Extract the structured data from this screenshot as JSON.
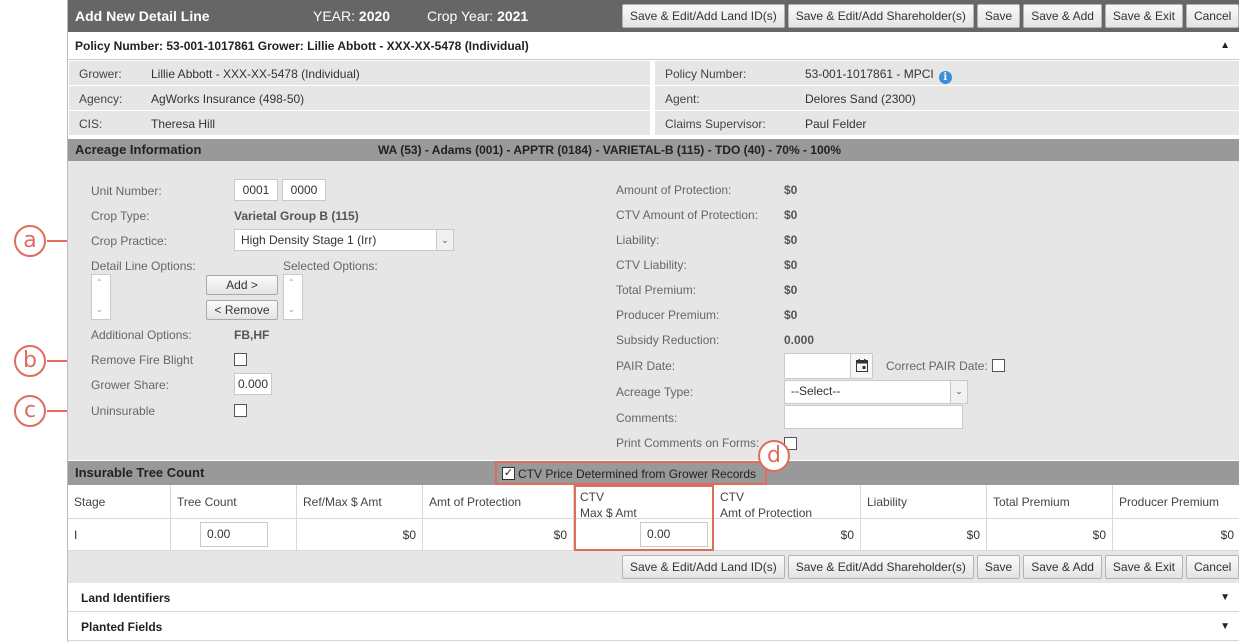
{
  "header": {
    "title": "Add New Detail Line",
    "year_label": "YEAR:",
    "year_value": "2020",
    "crop_year_label": "Crop Year:",
    "crop_year_value": "2021",
    "buttons": [
      "Save & Edit/Add Land ID(s)",
      "Save & Edit/Add Shareholder(s)",
      "Save",
      "Save & Add",
      "Save & Exit",
      "Cancel"
    ]
  },
  "policy_header": {
    "text": "Policy Number: 53-001-1017861 Grower: Lillie Abbott - XXX-XX-5478 (Individual)",
    "caret": "▲"
  },
  "info": {
    "grower_label": "Grower:",
    "grower_value": "Lillie Abbott - XXX-XX-5478 (Individual)",
    "policy_label": "Policy Number:",
    "policy_value": "53-001-1017861 - MPCI",
    "agency_label": "Agency:",
    "agency_value": "AgWorks Insurance (498-50)",
    "agent_label": "Agent:",
    "agent_value": "Delores Sand (2300)",
    "cis_label": "CIS:",
    "cis_value": "Theresa Hill",
    "supervisor_label": "Claims Supervisor:",
    "supervisor_value": "Paul Felder"
  },
  "acreage": {
    "title": "Acreage Information",
    "summary": "WA (53) - Adams (001) - APPTR (0184) - VARIETAL-B (115) - TDO (40) - 70% - 100%",
    "unit_label": "Unit Number:",
    "unit_a": "0001",
    "unit_b": "0000",
    "crop_type_label": "Crop Type:",
    "crop_type_value": "Varietal Group B (115)",
    "crop_practice_label": "Crop Practice:",
    "crop_practice_value": "High Density Stage 1 (Irr)",
    "detail_options_label": "Detail Line Options:",
    "selected_options_label": "Selected Options:",
    "add_label": "Add >",
    "remove_label": "< Remove",
    "additional_label": "Additional Options:",
    "additional_value": "FB,HF",
    "fire_blight_label": "Remove Fire Blight",
    "grower_share_label": "Grower Share:",
    "grower_share_value": "0.000",
    "uninsurable_label": "Uninsurable",
    "right": {
      "amount_protection_label": "Amount of Protection:",
      "amount_protection_value": "$0",
      "ctv_amount_label": "CTV Amount of Protection:",
      "ctv_amount_value": "$0",
      "liability_label": "Liability:",
      "liability_value": "$0",
      "ctv_liability_label": "CTV Liability:",
      "ctv_liability_value": "$0",
      "total_premium_label": "Total Premium:",
      "total_premium_value": "$0",
      "producer_premium_label": "Producer Premium:",
      "producer_premium_value": "$0",
      "subsidy_label": "Subsidy Reduction:",
      "subsidy_value": "0.000",
      "pair_date_label": "PAIR Date:",
      "correct_pair_label": "Correct PAIR Date:",
      "acreage_type_label": "Acreage Type:",
      "acreage_type_value": "--Select--",
      "comments_label": "Comments:",
      "print_comments_label": "Print Comments on Forms:"
    }
  },
  "tree_count": {
    "title": "Insurable Tree Count",
    "ctv_checkbox_label": "CTV Price Determined from Grower Records",
    "columns": [
      "Stage",
      "Tree Count",
      "Ref/Max $ Amt",
      "Amt of Protection",
      "CTV",
      "Max $ Amt",
      "CTV",
      "Amt of Protection",
      "Liability",
      "Total Premium",
      "Producer Premium"
    ],
    "row": {
      "stage": "I",
      "tree_count": "0.00",
      "ref_max": "$0",
      "amt_protection": "$0",
      "ctv_max": "0.00",
      "ctv_amt_protection": "$0",
      "liability": "$0",
      "total_premium": "$0",
      "producer_premium": "$0"
    }
  },
  "sections": {
    "land_identifiers": "Land Identifiers",
    "planted_fields": "Planted Fields",
    "caret": "▼"
  },
  "callouts": [
    "a",
    "b",
    "c",
    "d"
  ],
  "colors": {
    "title_bar": "#666666",
    "section_bar": "#999999",
    "panel": "#e6e6e6",
    "callout": "#e06c5e",
    "info_icon": "#3b8fd6"
  }
}
